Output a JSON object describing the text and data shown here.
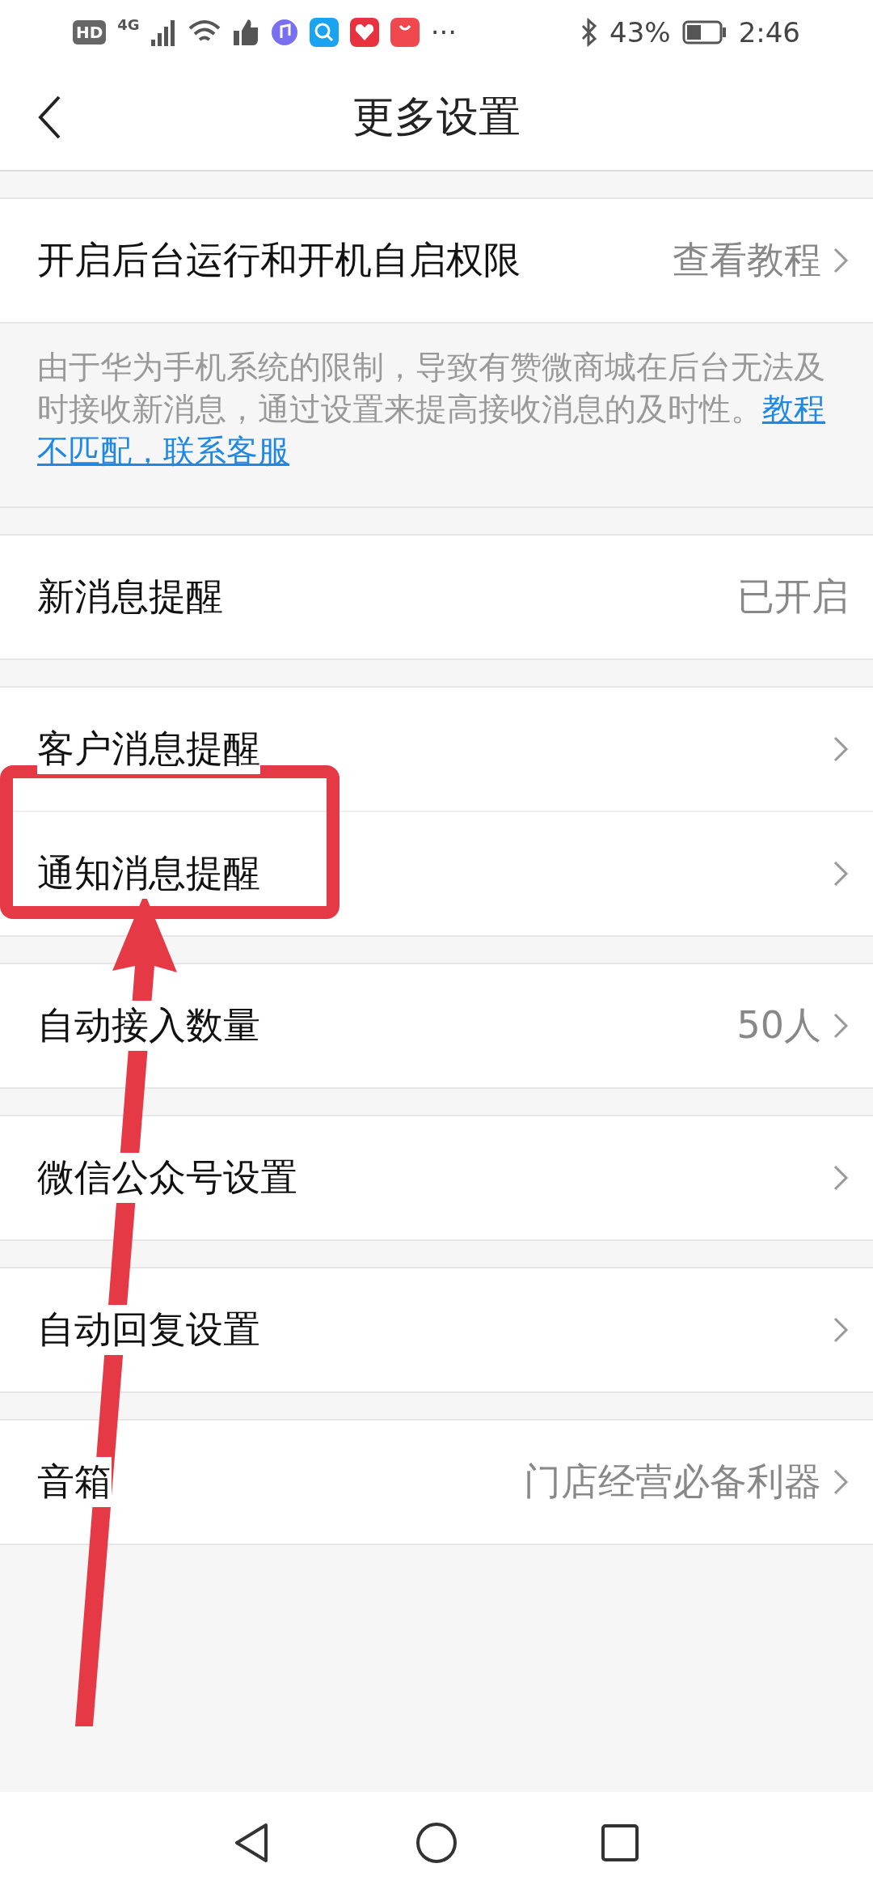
{
  "status_bar": {
    "hd": "HD",
    "network": "4G",
    "more": "···",
    "battery": "43%",
    "time": "2:46"
  },
  "header": {
    "title": "更多设置"
  },
  "sections": [
    {
      "rows": [
        {
          "label": "开启后台运行和开机自启权限",
          "value": "查看教程",
          "chevron": true
        }
      ],
      "note": {
        "text": "由于华为手机系统的限制，导致有赞微商城在后台无法及时接收新消息，通过设置来提高接收消息的及时性。",
        "link_lines": [
          "教程",
          "不匹配，联系客服"
        ]
      }
    },
    {
      "rows": [
        {
          "label": "新消息提醒",
          "value": "已开启",
          "chevron": false
        }
      ]
    },
    {
      "rows": [
        {
          "label": "客户消息提醒",
          "chevron": true
        },
        {
          "label": "通知消息提醒",
          "chevron": true
        }
      ]
    },
    {
      "rows": [
        {
          "label": "自动接入数量",
          "value": "50人",
          "chevron": true
        }
      ]
    },
    {
      "rows": [
        {
          "label": "微信公众号设置",
          "chevron": true
        }
      ]
    },
    {
      "rows": [
        {
          "label": "自动回复设置",
          "chevron": true
        }
      ]
    },
    {
      "rows": [
        {
          "label": "音箱",
          "value": "门店经营必备利器",
          "chevron": true
        }
      ]
    }
  ]
}
